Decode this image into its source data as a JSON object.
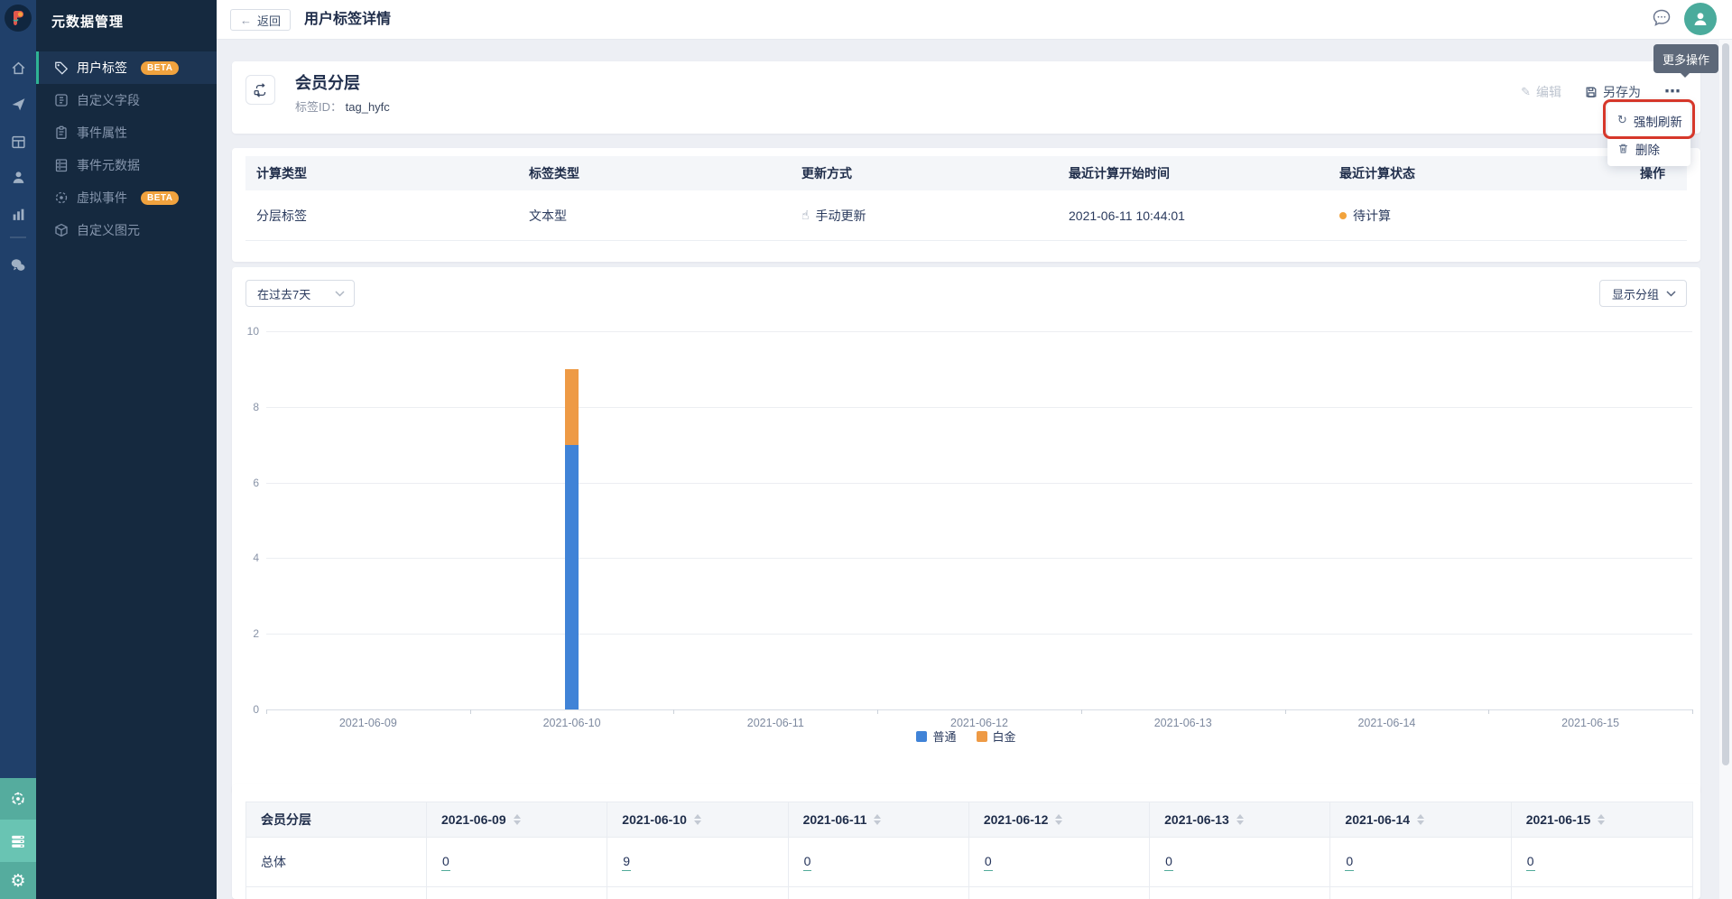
{
  "sidebar": {
    "title": "元数据管理",
    "items": [
      {
        "label": "用户标签",
        "badge": "BETA"
      },
      {
        "label": "自定义字段",
        "badge": ""
      },
      {
        "label": "事件属性",
        "badge": ""
      },
      {
        "label": "事件元数据",
        "badge": ""
      },
      {
        "label": "虚拟事件",
        "badge": "BETA"
      },
      {
        "label": "自定义图元",
        "badge": ""
      }
    ]
  },
  "topbar": {
    "back": "返回",
    "title": "用户标签详情"
  },
  "user_menu": {
    "tooltip": "更多操作"
  },
  "detail": {
    "title": "会员分层",
    "id_label": "标签ID：",
    "id_value": "tag_hyfc",
    "edit": "编辑",
    "save_as": "另存为"
  },
  "context_menu": {
    "items": [
      "强制刷新",
      "删除"
    ]
  },
  "info_table": {
    "headers": [
      "计算类型",
      "标签类型",
      "更新方式",
      "最近计算开始时间",
      "最近计算状态",
      "操作"
    ],
    "row": [
      "分层标签",
      "文本型",
      "手动更新",
      "2021-06-11 10:44:01",
      "待计算"
    ]
  },
  "filters": {
    "date_range": "在过去7天",
    "group_button": "显示分组"
  },
  "chart_data": {
    "type": "bar",
    "stacked": true,
    "title": "",
    "xlabel": "",
    "ylabel": "",
    "categories": [
      "2021-06-09",
      "2021-06-10",
      "2021-06-11",
      "2021-06-12",
      "2021-06-13",
      "2021-06-14",
      "2021-06-15"
    ],
    "series": [
      {
        "name": "普通",
        "color": "#4083d7",
        "values": [
          0,
          7,
          0,
          0,
          0,
          0,
          0
        ]
      },
      {
        "name": "白金",
        "color": "#ee9a45",
        "values": [
          0,
          2,
          0,
          0,
          0,
          0,
          0
        ]
      }
    ],
    "ylim": [
      0,
      10
    ],
    "yticks": [
      0,
      2,
      4,
      6,
      8,
      10
    ],
    "grid": true,
    "legend_position": "bottom"
  },
  "bottom_table": {
    "label_header": "会员分层",
    "dates": [
      "2021-06-09",
      "2021-06-10",
      "2021-06-11",
      "2021-06-12",
      "2021-06-13",
      "2021-06-14",
      "2021-06-15"
    ],
    "row_label": "总体",
    "values": [
      "0",
      "9",
      "0",
      "0",
      "0",
      "0",
      "0"
    ]
  },
  "icons": {
    "back": "←",
    "more": "⋯",
    "edit": "✎",
    "refresh": "↻",
    "hand": "☝",
    "gear": "⚙"
  },
  "colors": {
    "series_blue": "#4083d7",
    "series_orange": "#ee9a45",
    "teal_accent": "#4aab9c",
    "status_pending": "#f2a33c",
    "annotation_red": "#d6372a",
    "badge_orange": "#f0a23e"
  }
}
